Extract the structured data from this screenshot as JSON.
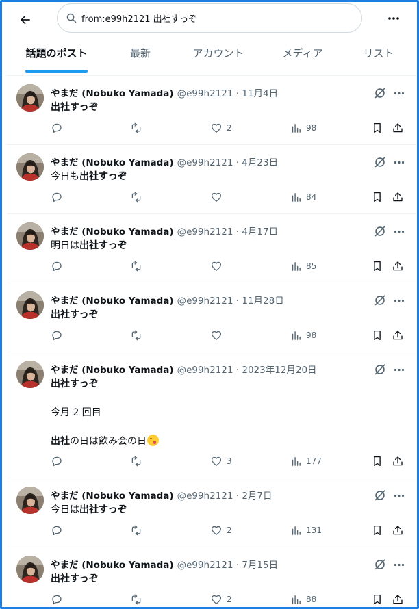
{
  "search": {
    "value": "from:e99h2121 出社すっぞ"
  },
  "tabs": [
    {
      "label": "話題のポスト",
      "active": true
    },
    {
      "label": "最新"
    },
    {
      "label": "アカウント"
    },
    {
      "label": "メディア"
    },
    {
      "label": "リスト"
    }
  ],
  "colors": {
    "accent": "#1d9bf0",
    "frame": "#1d7fe6",
    "muted": "#536471",
    "text": "#0f1419"
  },
  "posts": [
    {
      "author": "やまだ (Nobuko Yamada)",
      "handle": "@e99h2121 · 11月4日",
      "segments": [
        {
          "t": "出社すっぞ",
          "b": true
        }
      ],
      "likes": "2",
      "views": "98"
    },
    {
      "author": "やまだ (Nobuko Yamada)",
      "handle": "@e99h2121 · 4月23日",
      "segments": [
        {
          "t": "今日も"
        },
        {
          "t": "出社すっぞ",
          "b": true
        }
      ],
      "likes": "",
      "views": "84"
    },
    {
      "author": "やまだ (Nobuko Yamada)",
      "handle": "@e99h2121 · 4月17日",
      "segments": [
        {
          "t": "明日は"
        },
        {
          "t": "出社すっぞ",
          "b": true
        }
      ],
      "likes": "",
      "views": "85"
    },
    {
      "author": "やまだ (Nobuko Yamada)",
      "handle": "@e99h2121 · 11月28日",
      "segments": [
        {
          "t": "出社すっぞ",
          "b": true
        }
      ],
      "likes": "",
      "views": "98"
    },
    {
      "author": "やまだ (Nobuko Yamada)",
      "handle": "@e99h2121 · 2023年12月20日",
      "segments": [
        {
          "t": "出社すっぞ",
          "b": true
        },
        {
          "t": "\n\n今月 2 回目\n\n"
        },
        {
          "t": "出社",
          "b": true
        },
        {
          "t": "の日は飲み会の日"
        },
        {
          "emoji": "yum-face-icon"
        }
      ],
      "likes": "3",
      "views": "177"
    },
    {
      "author": "やまだ (Nobuko Yamada)",
      "handle": "@e99h2121 · 2月7日",
      "segments": [
        {
          "t": "今日は"
        },
        {
          "t": "出社すっぞ",
          "b": true
        }
      ],
      "likes": "2",
      "views": "131"
    },
    {
      "author": "やまだ (Nobuko Yamada)",
      "handle": "@e99h2121 · 7月15日",
      "segments": [
        {
          "t": "出社すっぞ",
          "b": true
        }
      ],
      "likes": "2",
      "views": "88"
    }
  ]
}
